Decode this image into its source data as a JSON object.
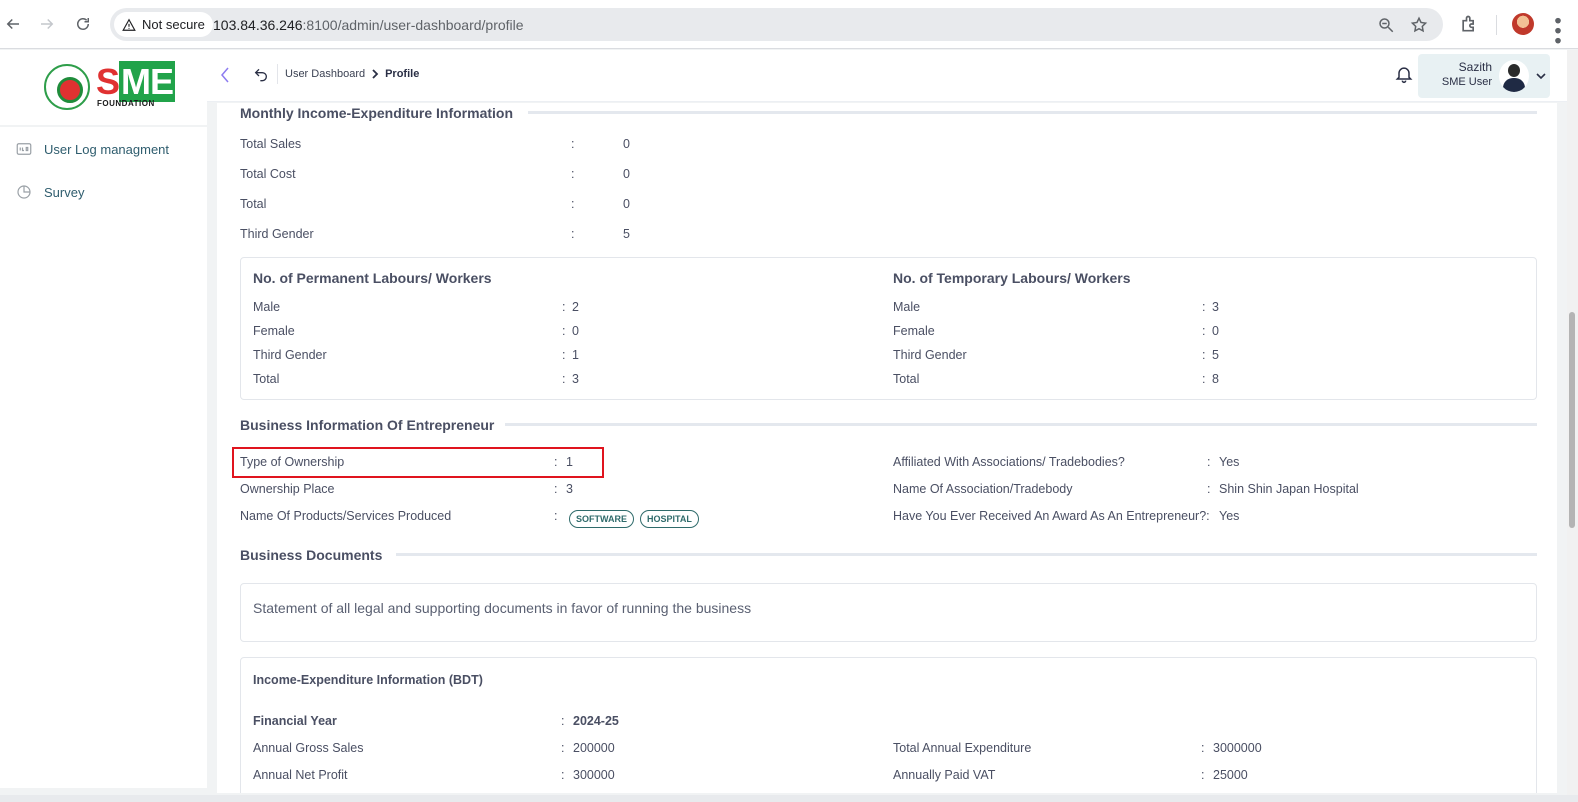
{
  "browser": {
    "security_label": "Not secure",
    "url_host": "103.84.36.246",
    "url_rest": ":8100/admin/user-dashboard/profile"
  },
  "sidebar": {
    "logo": {
      "text_s": "S",
      "text_me": "ME",
      "subtext": "FOUNDATION"
    },
    "items": [
      {
        "label": "User Log managment",
        "icon": "log-icon"
      },
      {
        "label": "Survey",
        "icon": "pie-chart-icon"
      }
    ]
  },
  "header": {
    "breadcrumb": {
      "parent": "User Dashboard",
      "current": "Profile"
    },
    "user": {
      "name": "Sazith",
      "role": "SME User"
    }
  },
  "monthly": {
    "title": "Monthly Income-Expenditure Information",
    "rows": [
      {
        "label": "Total Sales",
        "value": "0"
      },
      {
        "label": "Total Cost",
        "value": "0"
      },
      {
        "label": "Total",
        "value": "0"
      },
      {
        "label": "Third Gender",
        "value": "5"
      }
    ]
  },
  "labours": {
    "permanent": {
      "title": "No. of Permanent Labours/ Workers",
      "rows": [
        {
          "label": "Male",
          "value": "2"
        },
        {
          "label": "Female",
          "value": "0"
        },
        {
          "label": "Third Gender",
          "value": "1"
        },
        {
          "label": "Total",
          "value": "3"
        }
      ]
    },
    "temporary": {
      "title": "No. of Temporary Labours/ Workers",
      "rows": [
        {
          "label": "Male",
          "value": "3"
        },
        {
          "label": "Female",
          "value": "0"
        },
        {
          "label": "Third Gender",
          "value": "5"
        },
        {
          "label": "Total",
          "value": "8"
        }
      ]
    }
  },
  "business": {
    "title": "Business Information Of Entrepreneur",
    "left": [
      {
        "label": "Type of Ownership",
        "value": "1"
      },
      {
        "label": "Ownership Place",
        "value": "3"
      },
      {
        "label": "Name Of Products/Services Produced",
        "tags": [
          "SOFTWARE",
          "HOSPITAL"
        ]
      }
    ],
    "right": [
      {
        "label": "Affiliated With Associations/ Tradebodies?",
        "value": "Yes"
      },
      {
        "label": "Name Of Association/Tradebody",
        "value": "Shin Shin Japan Hospital"
      },
      {
        "label": "Have You Ever Received An Award As An Entrepreneur?:",
        "value": "Yes"
      }
    ]
  },
  "documents": {
    "title": "Business Documents",
    "statement": "Statement of all legal and supporting documents in favor of running the business"
  },
  "income": {
    "title": "Income-Expenditure Information (BDT)",
    "financial_year_label": "Financial Year",
    "financial_year_value": "2024-25",
    "left": [
      {
        "label": "Annual Gross Sales",
        "value": "200000"
      },
      {
        "label": "Annual Net Profit",
        "value": "300000"
      }
    ],
    "right": [
      {
        "label": "Total Annual Expenditure",
        "value": "3000000"
      },
      {
        "label": "Annually Paid VAT",
        "value": "25000"
      }
    ]
  },
  "colon": ":"
}
